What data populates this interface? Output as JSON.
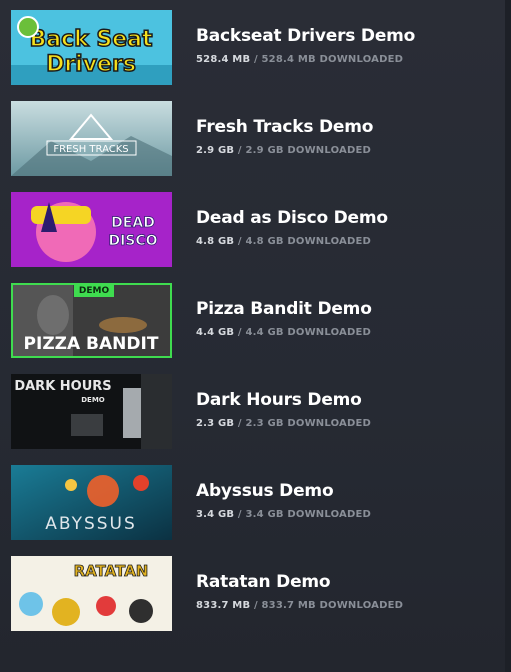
{
  "downloads": [
    {
      "title": "Backseat Drivers Demo",
      "current": "528.4 MB",
      "total": "528.4 MB",
      "label": "DOWNLOADED",
      "art_text": "Back Seat Drivers",
      "colors": {
        "bg": "#47b7d6",
        "accent": "#f6e01c"
      }
    },
    {
      "title": "Fresh Tracks Demo",
      "current": "2.9 GB",
      "total": "2.9 GB",
      "label": "DOWNLOADED",
      "art_text": "FRESH TRACKS",
      "colors": {
        "bg": "#9ec3c7",
        "accent": "#ffffff"
      }
    },
    {
      "title": "Dead as Disco Demo",
      "current": "4.8 GB",
      "total": "4.8 GB",
      "label": "DOWNLOADED",
      "art_text": "DEAD AS DISCO",
      "colors": {
        "bg": "#a623c9",
        "accent": "#f5d524"
      }
    },
    {
      "title": "Pizza Bandit Demo",
      "current": "4.4 GB",
      "total": "4.4 GB",
      "label": "DOWNLOADED",
      "art_text": "PIZZA BANDIT",
      "art_tag": "DEMO",
      "selected": true,
      "colors": {
        "bg": "#3a3a3a",
        "accent": "#3fdc4f"
      }
    },
    {
      "title": "Dark Hours Demo",
      "current": "2.3 GB",
      "total": "2.3 GB",
      "label": "DOWNLOADED",
      "art_text": "DARK HOURS",
      "art_tag": "DEMO",
      "colors": {
        "bg": "#111316",
        "accent": "#e8e8e8"
      }
    },
    {
      "title": "Abyssus Demo",
      "current": "3.4 GB",
      "total": "3.4 GB",
      "label": "DOWNLOADED",
      "art_text": "ABYSSUS",
      "colors": {
        "bg": "#0f4b63",
        "accent": "#f0602a"
      }
    },
    {
      "title": "Ratatan Demo",
      "current": "833.7 MB",
      "total": "833.7 MB",
      "label": "DOWNLOADED",
      "art_text": "RATATAN",
      "colors": {
        "bg": "#f4f1e6",
        "accent": "#e2b321"
      }
    }
  ]
}
